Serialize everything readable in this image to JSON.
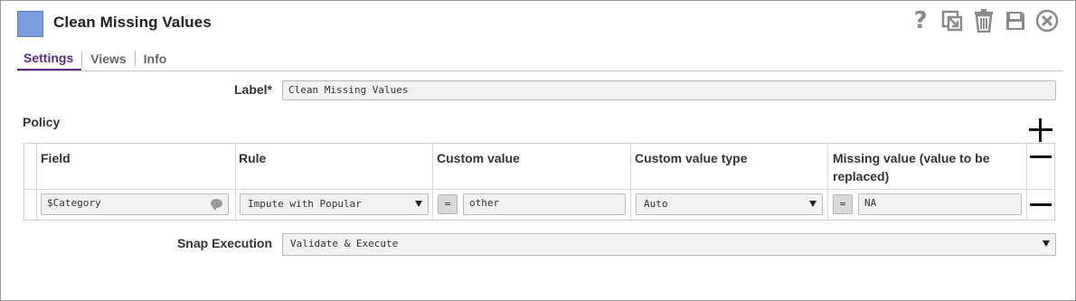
{
  "header": {
    "title": "Clean Missing Values",
    "icons": [
      "help-icon",
      "export-icon",
      "trash-icon",
      "save-icon",
      "close-icon"
    ]
  },
  "tabs": [
    {
      "label": "Settings",
      "active": true
    },
    {
      "label": "Views",
      "active": false
    },
    {
      "label": "Info",
      "active": false
    }
  ],
  "settings": {
    "label_field": {
      "label": "Label*",
      "value": "Clean Missing Values"
    },
    "policy": {
      "title": "Policy",
      "columns": [
        "Field",
        "Rule",
        "Custom value",
        "Custom value type",
        "Missing value (value to be replaced)"
      ],
      "rows": [
        {
          "field": "$Category",
          "rule": "Impute with Popular",
          "custom_value_mode": "=",
          "custom_value": "other",
          "custom_value_type": "Auto",
          "missing_value_mode": "=",
          "missing_value": "NA"
        }
      ]
    },
    "snap_execution": {
      "label": "Snap Execution",
      "value": "Validate & Execute"
    }
  },
  "colors": {
    "accent": "#5b2a86",
    "snap_icon": "#7b9ce0",
    "input_bg": "#f1f1f1"
  }
}
